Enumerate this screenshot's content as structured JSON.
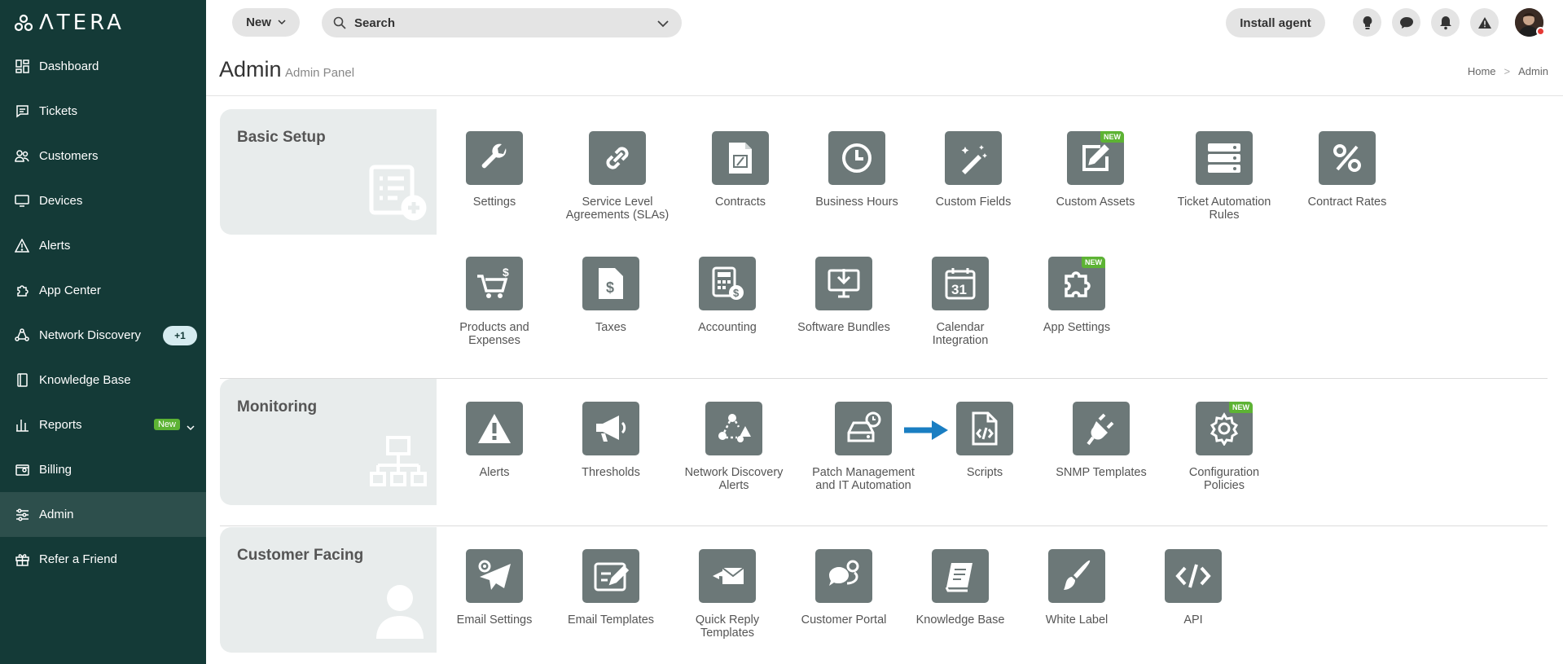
{
  "sidebar": {
    "logo_text": "ΛTERA",
    "items": [
      {
        "label": "Dashboard",
        "icon": "dashboard-icon"
      },
      {
        "label": "Tickets",
        "icon": "tickets-icon"
      },
      {
        "label": "Customers",
        "icon": "customers-icon"
      },
      {
        "label": "Devices",
        "icon": "devices-icon"
      },
      {
        "label": "Alerts",
        "icon": "alerts-icon"
      },
      {
        "label": "App Center",
        "icon": "app-center-icon"
      },
      {
        "label": "Network Discovery",
        "icon": "network-discovery-icon",
        "badge": "+1"
      },
      {
        "label": "Knowledge Base",
        "icon": "knowledge-base-icon"
      },
      {
        "label": "Reports",
        "icon": "reports-icon",
        "badge": "New"
      },
      {
        "label": "Billing",
        "icon": "billing-icon"
      },
      {
        "label": "Admin",
        "icon": "admin-icon",
        "active": true
      },
      {
        "label": "Refer a Friend",
        "icon": "gift-icon"
      }
    ]
  },
  "topbar": {
    "new_label": "New",
    "search_placeholder": "Search",
    "install_label": "Install agent",
    "icons": [
      "lightbulb-icon",
      "chat-icon",
      "bell-icon",
      "warning-icon"
    ]
  },
  "header": {
    "title": "Admin",
    "subtitle": "Admin Panel",
    "breadcrumb": [
      "Home",
      "Admin"
    ]
  },
  "sections": {
    "basic": {
      "title": "Basic Setup",
      "tiles": [
        {
          "label": "Settings",
          "icon": "wrench-icon"
        },
        {
          "label": "Service Level Agreements (SLAs)",
          "icon": "sla-link-icon"
        },
        {
          "label": "Contracts",
          "icon": "contract-icon"
        },
        {
          "label": "Business Hours",
          "icon": "clock-icon"
        },
        {
          "label": "Custom Fields",
          "icon": "magic-wand-icon"
        },
        {
          "label": "Custom Assets",
          "icon": "edit-note-icon",
          "new": "NEW"
        },
        {
          "label": "Ticket Automation Rules",
          "icon": "server-stack-icon"
        },
        {
          "label": "Contract Rates",
          "icon": "percent-icon"
        },
        {
          "label": "Products and Expenses",
          "icon": "cart-icon"
        },
        {
          "label": "Taxes",
          "icon": "tax-document-icon"
        },
        {
          "label": "Accounting",
          "icon": "calculator-icon"
        },
        {
          "label": "Software Bundles",
          "icon": "download-monitor-icon"
        },
        {
          "label": "Calendar Integration",
          "icon": "calendar-icon"
        },
        {
          "label": "App Settings",
          "icon": "puzzle-icon",
          "new": "NEW"
        }
      ]
    },
    "monitoring": {
      "title": "Monitoring",
      "tiles": [
        {
          "label": "Alerts",
          "icon": "alert-triangle-icon"
        },
        {
          "label": "Thresholds",
          "icon": "megaphone-icon"
        },
        {
          "label": "Network Discovery Alerts",
          "icon": "network-alert-icon"
        },
        {
          "label": "Patch Management and IT Automation",
          "icon": "patch-drive-icon"
        },
        {
          "label": "Scripts",
          "icon": "script-file-icon"
        },
        {
          "label": "SNMP Templates",
          "icon": "plug-icon"
        },
        {
          "label": "Configuration Policies",
          "icon": "config-gear-icon",
          "new": "NEW"
        }
      ]
    },
    "customer": {
      "title": "Customer Facing",
      "tiles": [
        {
          "label": "Email Settings",
          "icon": "email-gear-icon"
        },
        {
          "label": "Email Templates",
          "icon": "email-template-icon"
        },
        {
          "label": "Quick Reply Templates",
          "icon": "quick-reply-icon"
        },
        {
          "label": "Customer Portal",
          "icon": "portal-chat-icon"
        },
        {
          "label": "Knowledge Base",
          "icon": "book-icon"
        },
        {
          "label": "White Label",
          "icon": "brush-icon"
        },
        {
          "label": "API",
          "icon": "code-icon"
        }
      ]
    }
  },
  "colors": {
    "sidebar": "#143a37",
    "sidebar_active": "#2d4f4c",
    "tile": "#6c7878",
    "new_badge": "#5db334",
    "arrow": "#1a7ec2"
  }
}
